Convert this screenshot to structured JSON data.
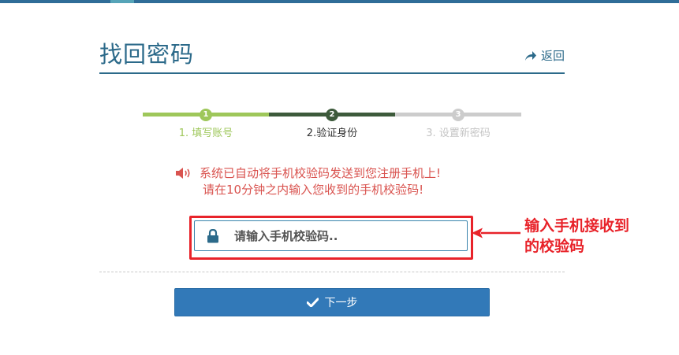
{
  "header": {
    "title": "找回密码",
    "back_label": "返回",
    "back_icon": "share-arrow-icon"
  },
  "steps": [
    {
      "number": "1",
      "label": "1. 填写账号",
      "state": "done",
      "color": "#9ec75a"
    },
    {
      "number": "2",
      "label": "2.验证身份",
      "state": "current",
      "color": "#3d5a3b"
    },
    {
      "number": "3",
      "label": "3. 设置新密码",
      "state": "pending",
      "color": "#cccccc"
    }
  ],
  "notice": {
    "icon": "speaker-icon",
    "line1": "系统已自动将手机校验码发送到您注册手机上!",
    "line2": "请在10分钟之内输入您收到的手机校验码!"
  },
  "code_field": {
    "icon": "lock-icon",
    "placeholder": "请输入手机校验码..",
    "value": ""
  },
  "annotation": {
    "line1": "输入手机接收到",
    "line2": "的校验码"
  },
  "next_button": {
    "icon": "check-icon",
    "label": "下一步"
  },
  "colors": {
    "primary": "#2c6a8a",
    "button": "#3279b8",
    "notice": "#d9534f",
    "highlight": "#e8232a",
    "step_done": "#9ec75a",
    "step_current": "#3d5a3b",
    "step_pending": "#cccccc"
  }
}
